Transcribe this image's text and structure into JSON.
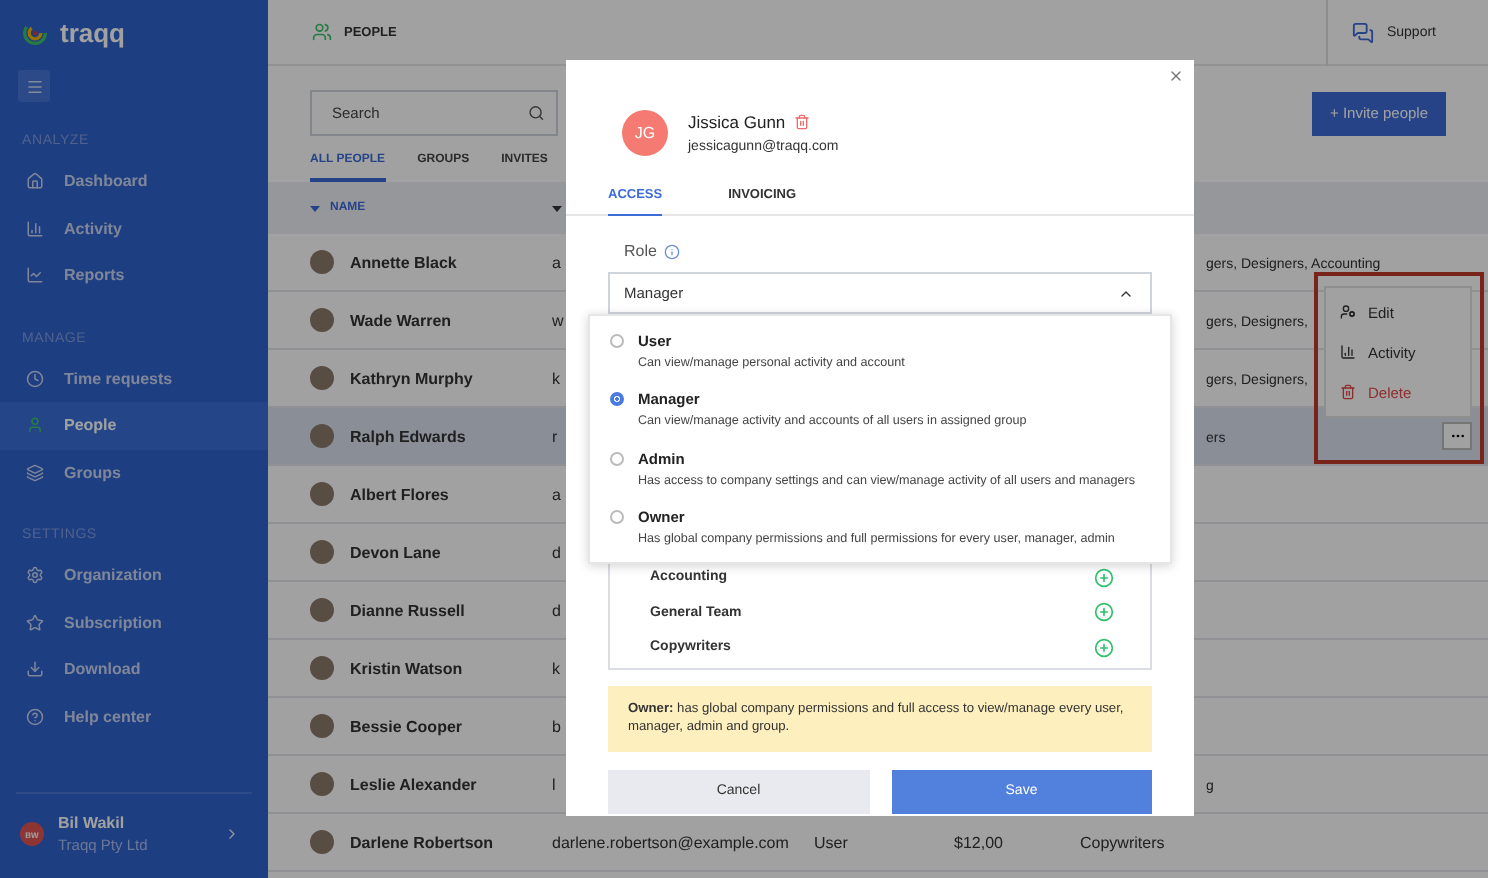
{
  "sidebar": {
    "logo": "traqq",
    "sections": [
      {
        "heading": "ANALYZE",
        "items": [
          {
            "label": "Dashboard",
            "selected": false
          },
          {
            "label": "Activity",
            "selected": false
          },
          {
            "label": "Reports",
            "selected": false
          }
        ]
      },
      {
        "heading": "MANAGE",
        "items": [
          {
            "label": "Time requests",
            "selected": false
          },
          {
            "label": "People",
            "selected": true
          },
          {
            "label": "Groups",
            "selected": false
          }
        ]
      },
      {
        "heading": "SETTINGS",
        "items": [
          {
            "label": "Organization",
            "selected": false
          },
          {
            "label": "Subscription",
            "selected": false
          },
          {
            "label": "Download",
            "selected": false
          },
          {
            "label": "Help center",
            "selected": false
          }
        ]
      }
    ],
    "user": {
      "initials": "BW",
      "name": "Bil Wakil",
      "company": "Traqq Pty Ltd"
    }
  },
  "header": {
    "title": "PEOPLE",
    "support": "Support"
  },
  "search": {
    "placeholder": "Search"
  },
  "invite_button": "+ Invite people",
  "tabs": [
    {
      "label": "ALL PEOPLE",
      "selected": true
    },
    {
      "label": "GROUPS",
      "selected": false
    },
    {
      "label": "INVITES",
      "selected": false
    }
  ],
  "table": {
    "columns": [
      "NAME"
    ],
    "rows": [
      {
        "name": "Annette Black",
        "email": "a",
        "groups": "gers, Designers, Accounting",
        "selected": false
      },
      {
        "name": "Wade Warren",
        "email": "w",
        "groups": "gers, Designers,",
        "selected": false
      },
      {
        "name": "Kathryn Murphy",
        "email": "k",
        "groups": "gers, Designers,",
        "selected": false
      },
      {
        "name": "Ralph Edwards",
        "email": "r",
        "groups": "ers",
        "selected": true
      },
      {
        "name": "Albert Flores",
        "email": "a",
        "selected": false
      },
      {
        "name": "Devon Lane",
        "email": "d",
        "selected": false
      },
      {
        "name": "Dianne Russell",
        "email": "d",
        "selected": false
      },
      {
        "name": "Kristin Watson",
        "email": "k",
        "selected": false
      },
      {
        "name": "Bessie Cooper",
        "email": "b",
        "selected": false
      },
      {
        "name": "Leslie Alexander",
        "email": "l",
        "groups": "g",
        "selected": false
      },
      {
        "name": "Darlene Robertson",
        "email": "darlene.robertson@example.com",
        "role": "User",
        "rate": "$12,00",
        "groups": "Copywriters",
        "selected": false
      }
    ]
  },
  "row_menu": {
    "items": [
      {
        "label": "Edit",
        "kind": "edit"
      },
      {
        "label": "Activity",
        "kind": "activity"
      },
      {
        "label": "Delete",
        "kind": "delete"
      }
    ]
  },
  "modal": {
    "initials": "JG",
    "name": "Jissica Gunn",
    "email": "jessicagunn@traqq.com",
    "tabs": [
      {
        "label": "ACCESS",
        "selected": true
      },
      {
        "label": "INVOICING",
        "selected": false
      }
    ],
    "role_label": "Role",
    "role_value": "Manager",
    "role_options": [
      {
        "title": "User",
        "description": "Can view/manage personal activity and account",
        "selected": false
      },
      {
        "title": "Manager",
        "description": "Can view/manage activity and accounts of all users in assigned group",
        "selected": true
      },
      {
        "title": "Admin",
        "description": "Has access to company settings and can view/manage activity of all users and managers",
        "selected": false
      },
      {
        "title": "Owner",
        "description": "Has global company permissions and full permissions for every user, manager, admin",
        "selected": false
      }
    ],
    "groups": [
      "Accounting",
      "General Team",
      "Copywriters"
    ],
    "note": "**Owner:** has global company permissions and full access to view/manage every user, manager, admin and group.",
    "cancel_button": "Cancel",
    "save_button": "Save"
  }
}
